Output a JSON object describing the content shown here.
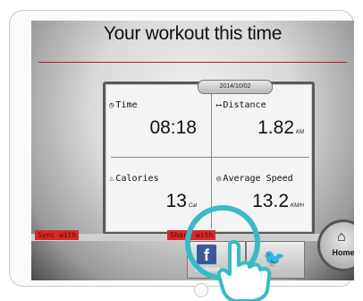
{
  "screen": {
    "title": "Your workout this time",
    "date": "2014/10/02"
  },
  "stats": {
    "time": {
      "label": "Time",
      "value": "08:18",
      "unit": ""
    },
    "distance": {
      "label": "Distance",
      "value": "1.82",
      "unit": "KM"
    },
    "calories": {
      "label": "Calories",
      "value": "13",
      "unit": "Cal"
    },
    "avg_speed": {
      "label": "Average Speed",
      "value": "13.2",
      "unit": "KM/H"
    }
  },
  "actions": {
    "sync_label": "Sync with",
    "share_label": "Share with",
    "facebook_label": "facebook",
    "home_label": "Home"
  },
  "icons": {
    "clock": "clock-icon",
    "distance": "distance-icon",
    "calories": "flame-icon",
    "speed": "speed-icon",
    "facebook": "facebook-icon",
    "twitter": "twitter-icon",
    "home": "home-icon",
    "hand": "pointing-hand-icon"
  },
  "colors": {
    "accent_red": "#d42a2a",
    "facebook_blue": "#3b5998",
    "twitter_blue": "#2a9fd6",
    "touch_ring": "#39bbc6"
  }
}
